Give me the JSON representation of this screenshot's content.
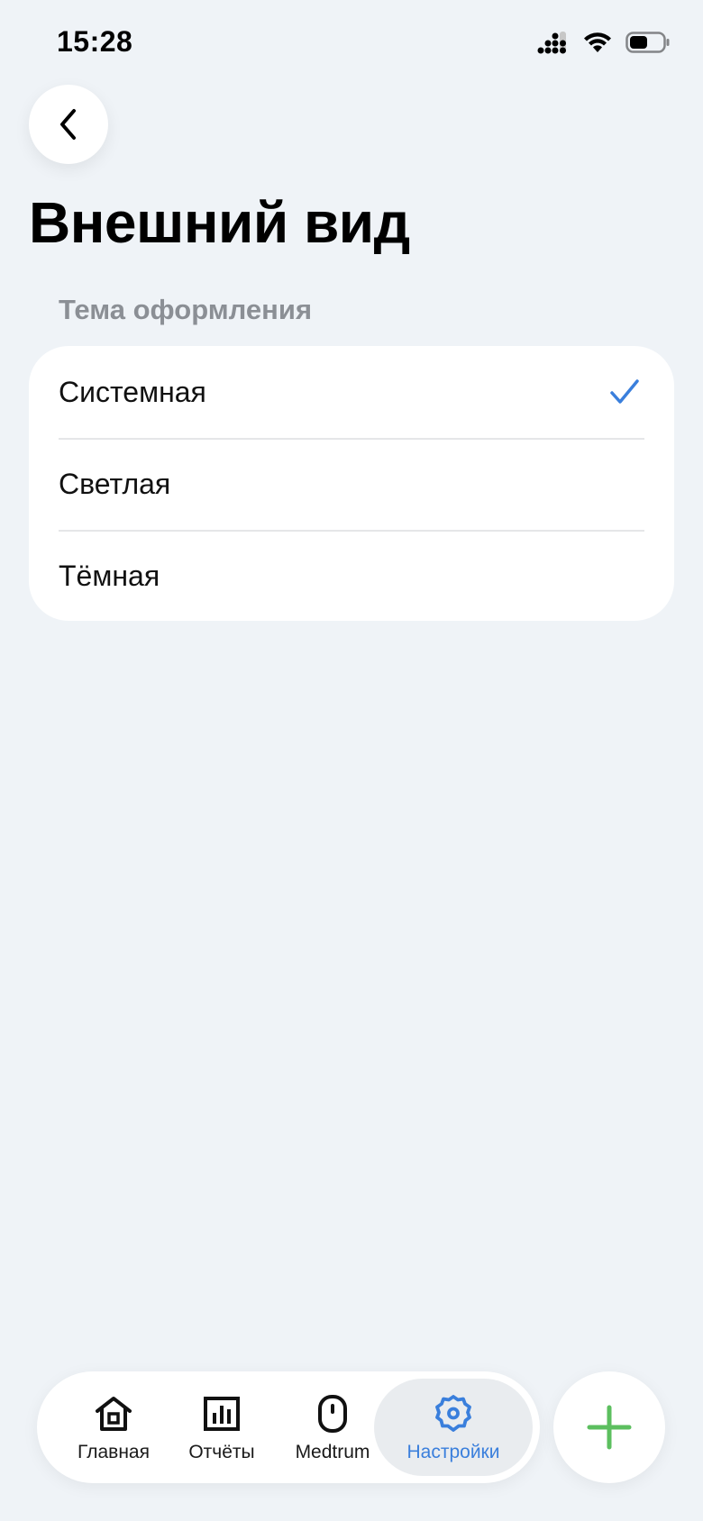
{
  "status_bar": {
    "time": "15:28"
  },
  "header": {
    "back_icon": "chevron-left-icon",
    "title": "Внешний вид"
  },
  "appearance": {
    "section_label": "Тема оформления",
    "options": [
      {
        "label": "Системная",
        "selected": true
      },
      {
        "label": "Светлая",
        "selected": false
      },
      {
        "label": "Тёмная",
        "selected": false
      }
    ],
    "check_color": "#3a7fdc"
  },
  "tab_bar": {
    "items": [
      {
        "label": "Главная",
        "icon": "home-icon",
        "active": false
      },
      {
        "label": "Отчёты",
        "icon": "bar-chart-icon",
        "active": false
      },
      {
        "label": "Medtrum",
        "icon": "sensor-icon",
        "active": false
      },
      {
        "label": "Настройки",
        "icon": "gear-icon",
        "active": true
      }
    ],
    "active_color": "#3a7fdc"
  },
  "add_button": {
    "icon": "plus-icon",
    "color": "#5cbf5f"
  }
}
